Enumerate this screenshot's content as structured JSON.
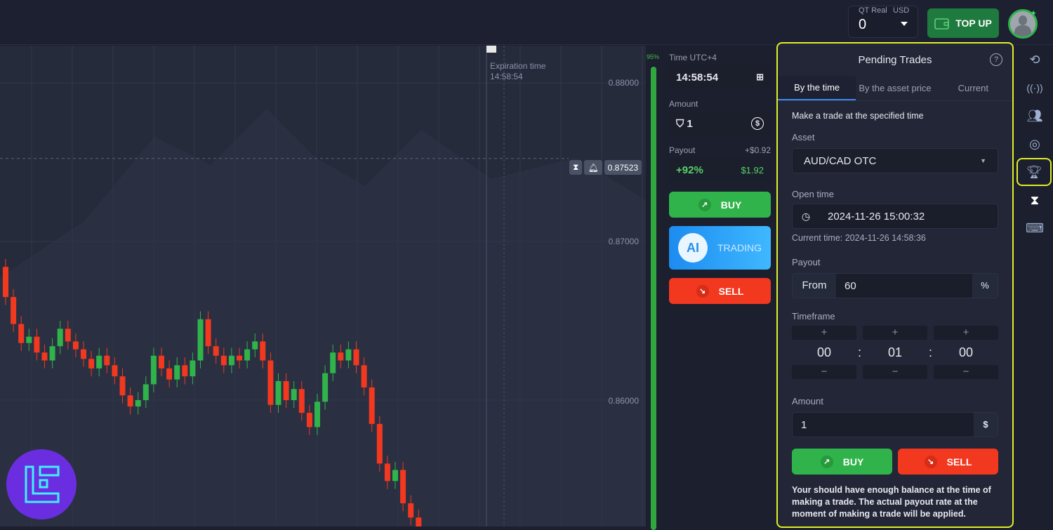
{
  "header": {
    "account_type": "QT Real",
    "currency": "USD",
    "balance": "0",
    "topup_label": "TOP UP"
  },
  "chart": {
    "price_labels": [
      "0.88000",
      "0.87000",
      "0.86000"
    ],
    "expiration_label": "Expiration time",
    "expiration_time": "14:58:54",
    "current_price": "0.87523",
    "payout_bar_pct": "95%"
  },
  "chart_data": {
    "type": "candlestick",
    "y_ticks": [
      0.88,
      0.87,
      0.86
    ],
    "start_open": 0.8684,
    "closes": [
      0.8665,
      0.8648,
      0.8636,
      0.864,
      0.863,
      0.8625,
      0.8634,
      0.8645,
      0.8637,
      0.8632,
      0.8626,
      0.862,
      0.8628,
      0.8622,
      0.8615,
      0.8603,
      0.8596,
      0.86,
      0.861,
      0.8628,
      0.862,
      0.8613,
      0.8622,
      0.8615,
      0.8625,
      0.8651,
      0.8634,
      0.8628,
      0.8622,
      0.8628,
      0.8625,
      0.8632,
      0.8637,
      0.8625,
      0.8597,
      0.8612,
      0.86,
      0.8607,
      0.8592,
      0.8583,
      0.8599,
      0.8617,
      0.863,
      0.8625,
      0.8632,
      0.8622,
      0.8608,
      0.8585,
      0.856,
      0.8549,
      0.8556,
      0.8535,
      0.8526,
      0.852
    ],
    "up_color": "#2fb34a",
    "down_color": "#f2381f"
  },
  "trade": {
    "time_label": "Time UTC+4",
    "time": "14:58:54",
    "amount_label": "Amount",
    "amount": "1",
    "payout_label": "Payout",
    "payout_profit": "+$0.92",
    "payout_pct": "+92%",
    "payout_total": "$1.92",
    "buy": "BUY",
    "ai_badge": "AI",
    "ai_label": "TRADING",
    "sell": "SELL"
  },
  "pending": {
    "title": "Pending Trades",
    "tabs": [
      "By the time",
      "By the asset price",
      "Current"
    ],
    "subtitle": "Make a trade at the specified time",
    "asset_label": "Asset",
    "asset": "AUD/CAD OTC",
    "open_time_label": "Open time",
    "open_time": "2024-11-26 15:00:32",
    "current_time": "Current time: 2024-11-26 14:58:36",
    "payout_label": "Payout",
    "payout_from": "From",
    "payout_value": "60",
    "payout_unit": "%",
    "timeframe_label": "Timeframe",
    "timeframe": [
      "00",
      "01",
      "00"
    ],
    "amount_label": "Amount",
    "amount": "1",
    "amount_unit": "$",
    "buy": "BUY",
    "sell": "SELL",
    "note": "Your should have enough balance at the time of making a trade. The actual payout rate at the moment of making a trade will be applied."
  },
  "sidebar": [
    "history-icon",
    "signals-icon",
    "social-trading-icon",
    "target-icon",
    "tournaments-icon",
    "pending-trades-icon",
    "keyboard-icon"
  ],
  "colors": {
    "accent_green": "#2fb34a",
    "accent_red": "#f2381f",
    "highlight": "#dfef27"
  }
}
